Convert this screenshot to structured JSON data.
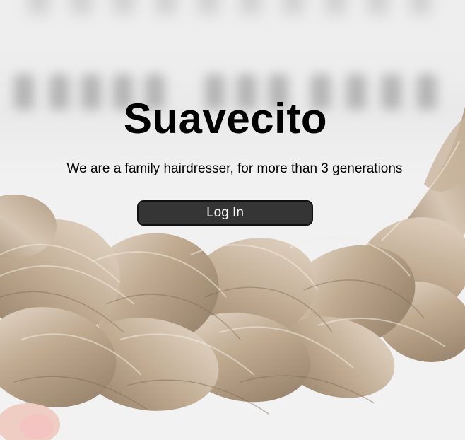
{
  "hero": {
    "title": "Suavecito",
    "subtitle": "We are a family hairdresser, for more than 3 generations",
    "login_label": "Log In"
  },
  "colors": {
    "background": "#efefef",
    "button_bg": "#353535",
    "button_border": "#111111",
    "button_text": "#ffffff",
    "text": "#000000",
    "hair_light": "#e3d6c6",
    "hair_mid": "#b9a48c",
    "hair_dark": "#8f7a64",
    "nail": "#f3c9c6"
  }
}
